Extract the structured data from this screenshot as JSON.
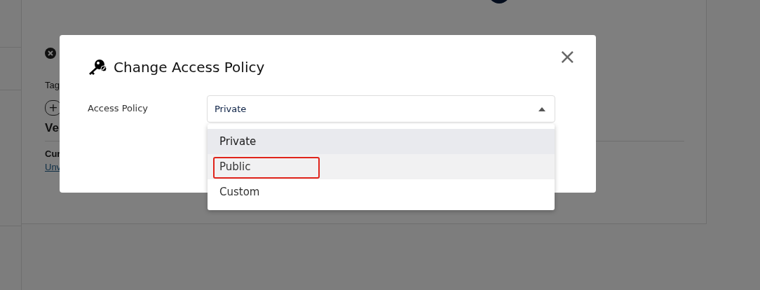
{
  "background": {
    "tags_label": "Tag",
    "add_tag": "+",
    "section_title": "Ve",
    "sub_label": "Cur",
    "sub_link": "Unv"
  },
  "dialog": {
    "title": "Change Access Policy",
    "close": "×",
    "field": {
      "label": "Access Policy",
      "value": "Private",
      "expanded": true
    },
    "options": [
      {
        "label": "Private",
        "selected": true,
        "hovered": false,
        "annotated": false
      },
      {
        "label": "Public",
        "selected": false,
        "hovered": true,
        "annotated": true
      },
      {
        "label": "Custom",
        "selected": false,
        "hovered": false,
        "annotated": false
      }
    ]
  }
}
